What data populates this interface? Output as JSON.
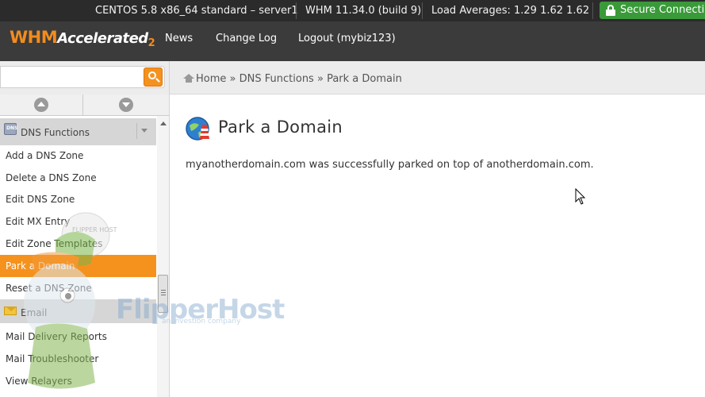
{
  "statusbar": {
    "os": "CENTOS 5.8 x86_64 standard – server1",
    "whm_version": "WHM 11.34.0 (build 9)",
    "load": "Load Averages: 1.29 1.62 1.62",
    "secure": "Secure Connection"
  },
  "header": {
    "logo_whm": "WHM",
    "logo_accelerated": "Accelerated",
    "logo_version": "2",
    "nav": [
      "News",
      "Change Log",
      "Logout (mybiz123)"
    ]
  },
  "search": {
    "value": "",
    "placeholder": ""
  },
  "breadcrumb": {
    "home": "Home",
    "sep": "»",
    "section": "DNS Functions",
    "current": "Park a Domain"
  },
  "sidebar": {
    "dns_section": "DNS Functions",
    "dns_items": [
      "Add a DNS Zone",
      "Delete a DNS Zone",
      "Edit DNS Zone",
      "Edit MX Entry",
      "Edit Zone Templates",
      "Park a Domain",
      "Reset a DNS Zone"
    ],
    "active_item": "Park a Domain",
    "email_section": "Email",
    "email_items": [
      "Mail Delivery Reports",
      "Mail Troubleshooter",
      "View Relayers"
    ]
  },
  "watermark": {
    "brand_left": "Flipper",
    "brand_right": "Host",
    "tagline": "an investion company",
    "badge": "FLIPPER HOST"
  },
  "main": {
    "title": "Park a Domain",
    "message": "myanotherdomain.com was successfully parked on top of anotherdomain.com."
  },
  "colors": {
    "accent": "#f5921e",
    "header_bg": "#3b3b3b",
    "statusbar_bg": "#2b2b2b",
    "secure_bg": "#3a9a3a"
  },
  "icons": {
    "secure": "lock-icon",
    "search": "search-icon",
    "home": "home-icon",
    "scroll_up": "chevron-up-icon",
    "scroll_down": "chevron-down-icon",
    "dns": "dns-icon",
    "email": "envelope-icon",
    "page": "park-domain-icon"
  }
}
